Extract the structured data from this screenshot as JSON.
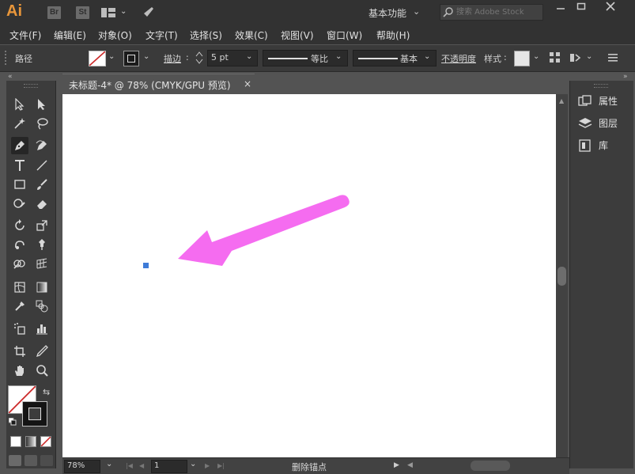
{
  "titlebar": {
    "app_logo": "Ai",
    "bridge_badge": "Br",
    "stock_badge": "St",
    "workspace": "基本功能",
    "search_placeholder": "搜索 Adobe Stock",
    "icons": [
      "layout-icon",
      "chevron-down-icon",
      "rocket-icon",
      "search-icon",
      "minimize-icon",
      "maximize-icon",
      "close-icon"
    ]
  },
  "menubar": {
    "items": [
      "文件(F)",
      "编辑(E)",
      "对象(O)",
      "文字(T)",
      "选择(S)",
      "效果(C)",
      "视图(V)",
      "窗口(W)",
      "帮助(H)"
    ]
  },
  "controlbar": {
    "selection_type": "路径",
    "stroke_label": "描边",
    "stroke_value": "5 pt",
    "profile_label": "等比",
    "brush_label": "基本",
    "opacity_label": "不透明度",
    "style_label": "样式",
    "colors": {
      "fill_none_slash": "#cc2a2a",
      "style_swatch": "#e6e6e6"
    }
  },
  "document": {
    "tab_label": "未标题-4* @ 78% (CMYK/GPU 预览)",
    "close_glyph": "×",
    "anchor_color": "#3e7bd8",
    "annotation_arrow_color": "#f56cf0"
  },
  "rightpanel": {
    "items": [
      "属性",
      "图层",
      "库"
    ]
  },
  "statusbar": {
    "zoom": "78%",
    "artboard": "1",
    "status_text": "删除锚点"
  },
  "colors": {
    "accent_ai": "#e8963a",
    "chrome_dark": "#323232",
    "panel": "#3c3c3c",
    "workspace_bg": "#535353"
  }
}
